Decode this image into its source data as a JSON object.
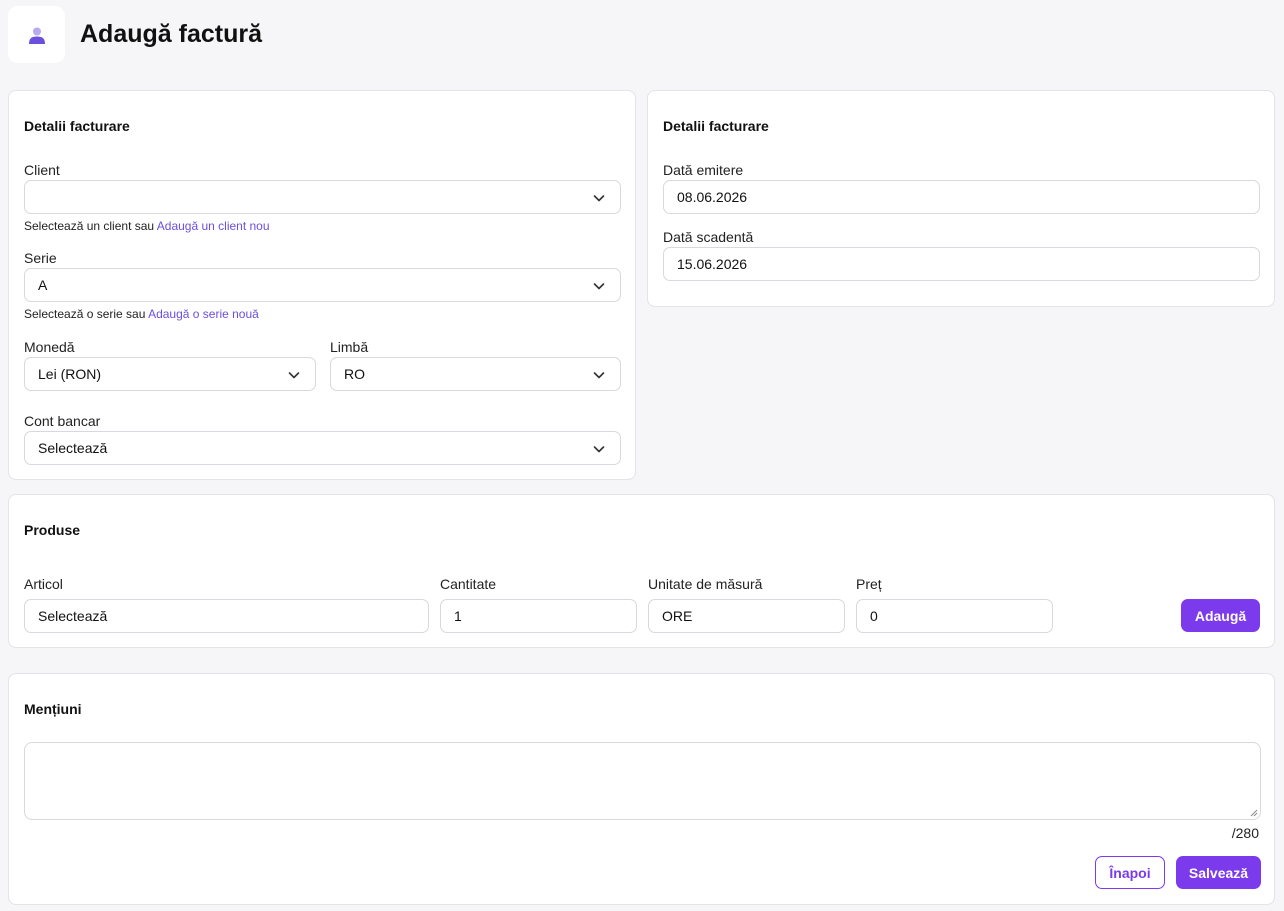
{
  "header": {
    "title": "Adaugă factură",
    "avatar_icon": "user-icon"
  },
  "billing": {
    "title": "Detalii facturare",
    "client": {
      "label": "Client",
      "value": "",
      "hint_text": "Selectează un client sau ",
      "hint_link": "Adaugă un client nou"
    },
    "series": {
      "label": "Serie",
      "value": "A",
      "hint_text": "Selectează o serie sau ",
      "hint_link": "Adaugă o serie nouă"
    },
    "currency": {
      "label": "Monedă",
      "value": "Lei (RON)"
    },
    "language": {
      "label": "Limbă",
      "value": "RO"
    },
    "bank_account": {
      "label": "Cont bancar",
      "value": "Selectează"
    }
  },
  "dates": {
    "title": "Detalii facturare",
    "issue": {
      "label": "Dată emitere",
      "value": "08.06.2026"
    },
    "due": {
      "label": "Dată scadentă",
      "value": "15.06.2026"
    }
  },
  "products": {
    "title": "Produse",
    "article": {
      "label": "Articol",
      "value": "Selectează"
    },
    "quantity": {
      "label": "Cantitate",
      "value": "1"
    },
    "unit": {
      "label": "Unitate de măsură",
      "value": "ORE"
    },
    "price": {
      "label": "Preț",
      "value": "0"
    },
    "add_label": "Adaugă"
  },
  "notes": {
    "title": "Mențiuni",
    "value": "",
    "counter": "/280",
    "back_label": "Înapoi",
    "save_label": "Salvează"
  },
  "colors": {
    "accent": "#7c3aed",
    "link": "#6d4fe0",
    "background": "#f6f6f8"
  }
}
